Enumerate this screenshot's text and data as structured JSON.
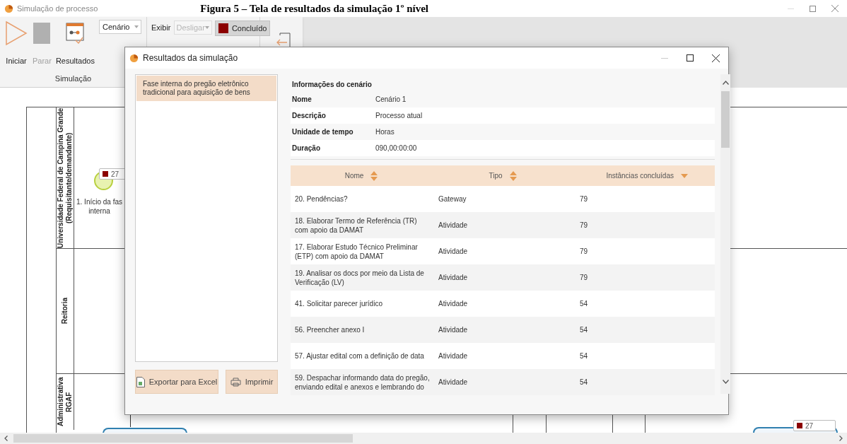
{
  "app": {
    "title": "Simulação de processo",
    "caption": "Figura 5 – Tela de resultados da simulação 1º nível"
  },
  "ribbon": {
    "buttons": [
      {
        "label": "Iniciar",
        "kind": "play",
        "disabled": false
      },
      {
        "label": "Parar",
        "kind": "stop",
        "disabled": true
      },
      {
        "label": "Resultados",
        "kind": "results",
        "disabled": false
      }
    ],
    "scenario_select": {
      "value": "Cenário"
    },
    "show_label": "Exibir",
    "show_select": {
      "value": "Desligar",
      "disabled": true
    },
    "status_button": {
      "label": "Concluído",
      "color": "#8b0000"
    },
    "group_label": "Simulação"
  },
  "diagram": {
    "lanes": [
      {
        "label": "Universidade Federal de Campina Grande (Requisitante/demandante)"
      },
      {
        "label": "Reitoria"
      },
      {
        "label": "Administrativa RGAF"
      }
    ],
    "start_event": {
      "count": "27",
      "label_lines": [
        "1. Início da fas",
        "interna"
      ]
    },
    "task_badge": {
      "count": "27"
    }
  },
  "dialog": {
    "title": "Resultados da simulação",
    "processes": [
      {
        "label": "Fase interna do pregão eletrônico tradicional para aquisição de bens",
        "selected": true
      }
    ],
    "buttons": [
      {
        "label": "Exportar para Excel",
        "kind": "excel"
      },
      {
        "label": "Imprimir",
        "kind": "print"
      }
    ],
    "info": {
      "heading": "Informações do cenário",
      "rows": [
        {
          "label": "Nome",
          "value": "Cenário 1"
        },
        {
          "label": "Descrição",
          "value": "Processo atual"
        },
        {
          "label": "Unidade de tempo",
          "value": "Horas"
        },
        {
          "label": "Duração",
          "value": "090,00:00:00"
        }
      ]
    },
    "table": {
      "columns": [
        {
          "label": "Nome",
          "kind": "sortable"
        },
        {
          "label": "Tipo",
          "kind": "sortable"
        },
        {
          "label": "Instâncias concluídas",
          "kind": "sorted"
        }
      ],
      "rows": [
        {
          "name": "20. Pendências?",
          "type": "Gateway",
          "count": "79"
        },
        {
          "name": "18. Elaborar Termo de Referência (TR)  com apoio da DAMAT",
          "type": "Atividade",
          "count": "79"
        },
        {
          "name": "17. Elaborar Estudo Técnico Preliminar (ETP) com apoio da DAMAT",
          "type": "Atividade",
          "count": "79"
        },
        {
          "name": "19. Analisar os docs por meio da Lista de Verificação (LV)",
          "type": "Atividade",
          "count": "79"
        },
        {
          "name": "41. Solicitar parecer jurídico",
          "type": "Atividade",
          "count": "54"
        },
        {
          "name": "56. Preencher anexo I",
          "type": "Atividade",
          "count": "54"
        },
        {
          "name": "57. Ajustar edital com a definição de data",
          "type": "Atividade",
          "count": "54"
        },
        {
          "name": "59. Despachar informando data do pregão, enviando edital e anexos e lembrando do",
          "type": "Atividade",
          "count": "54"
        }
      ]
    }
  }
}
